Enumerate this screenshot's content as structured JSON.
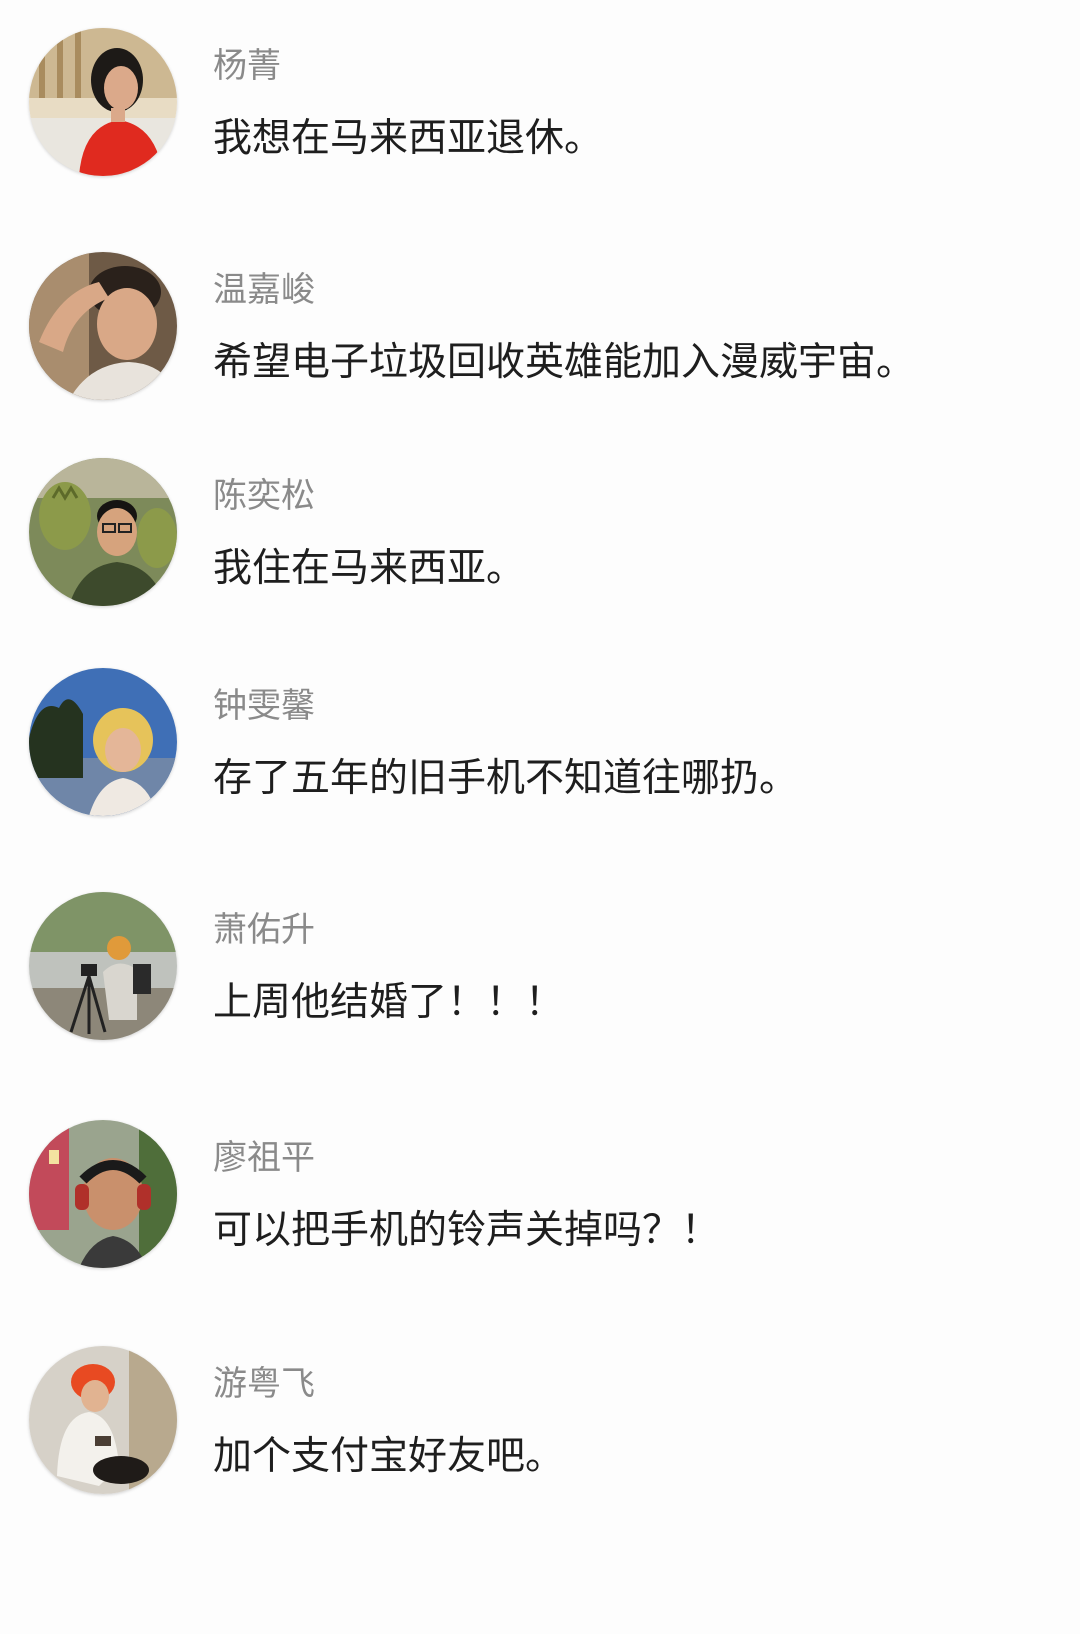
{
  "comments": [
    {
      "name": "杨菁",
      "text": "我想在马来西亚退休。"
    },
    {
      "name": "温嘉峻",
      "text": "希望电子垃圾回收英雄能加入漫威宇宙。"
    },
    {
      "name": "陈奕松",
      "text": "我住在马来西亚。"
    },
    {
      "name": "钟雯馨",
      "text": "存了五年的旧手机不知道往哪扔。"
    },
    {
      "name": "萧佑升",
      "text": "上周他结婚了！！！"
    },
    {
      "name": "廖祖平",
      "text": "可以把手机的铃声关掉吗？！"
    },
    {
      "name": "游粤飞",
      "text": "加个支付宝好友吧。"
    }
  ]
}
